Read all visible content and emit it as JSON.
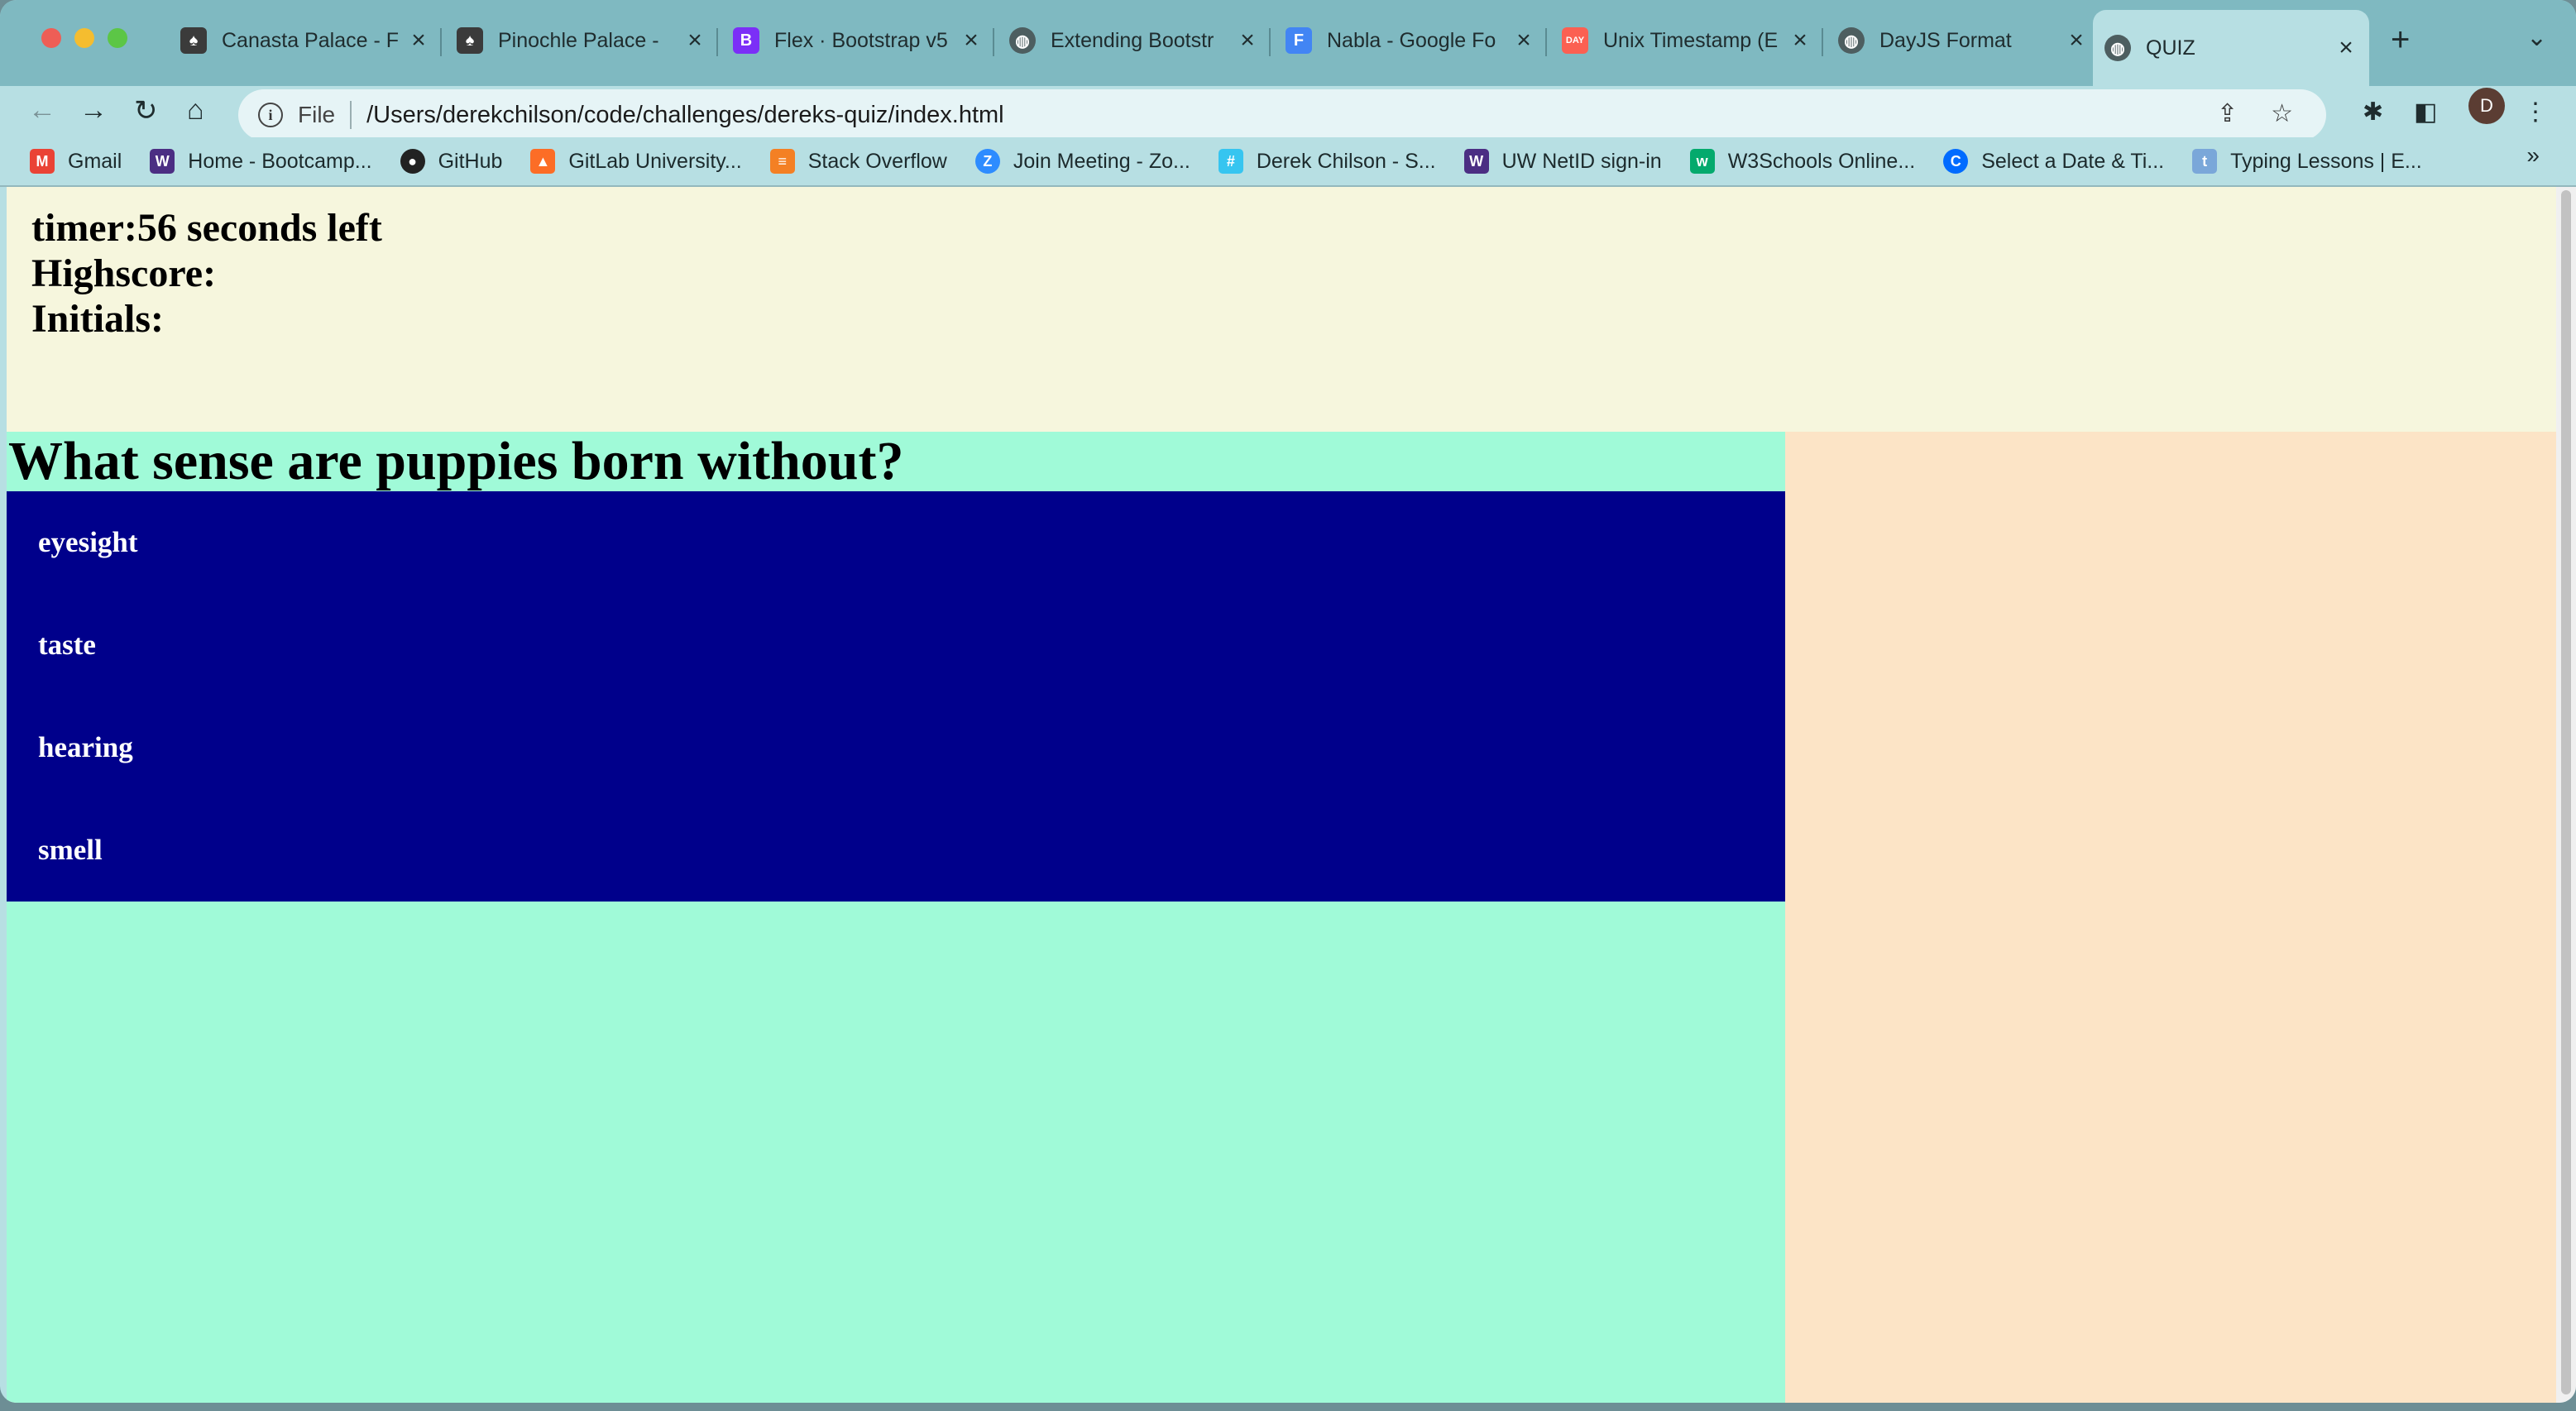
{
  "browser": {
    "tabs": [
      {
        "title": "Canasta Palace - F",
        "icon": "card-icon",
        "color": "#3b3b3b"
      },
      {
        "title": "Pinochle Palace -",
        "icon": "card-icon",
        "color": "#3b3b3b"
      },
      {
        "title": "Flex · Bootstrap v5",
        "icon": "bootstrap-icon",
        "color": "#7b2ff7"
      },
      {
        "title": "Extending Bootstr",
        "icon": "globe-icon",
        "color": "#333333"
      },
      {
        "title": "Nabla - Google Fo",
        "icon": "google-fonts-icon",
        "color": "#4285f4"
      },
      {
        "title": "Unix Timestamp (E",
        "icon": "dayjs-icon",
        "color": "#fb6052"
      },
      {
        "title": "DayJS Format",
        "icon": "globe-icon",
        "color": "#333333"
      },
      {
        "title": "QUIZ",
        "icon": "globe-icon",
        "color": "#333333",
        "active": true
      }
    ],
    "address": {
      "scheme": "File",
      "url": "/Users/derekchilson/code/challenges/dereks-quiz/index.html"
    },
    "profile_initial": "D",
    "bookmarks": [
      {
        "label": "Gmail",
        "icon": "gmail-icon",
        "color": "#ea4335",
        "glyph": "M"
      },
      {
        "label": "Home - Bootcamp...",
        "icon": "uw-icon",
        "color": "#4b2e83",
        "glyph": "W"
      },
      {
        "label": "GitHub",
        "icon": "github-icon",
        "color": "#222222",
        "glyph": "●"
      },
      {
        "label": "GitLab University...",
        "icon": "gitlab-icon",
        "color": "#fc6d26",
        "glyph": "▲"
      },
      {
        "label": "Stack Overflow",
        "icon": "stackoverflow-icon",
        "color": "#f48024",
        "glyph": "≡"
      },
      {
        "label": "Join Meeting - Zo...",
        "icon": "zoom-icon",
        "color": "#2d8cff",
        "glyph": "Z"
      },
      {
        "label": "Derek Chilson - S...",
        "icon": "slack-icon",
        "color": "#36c5f0",
        "glyph": "#"
      },
      {
        "label": "UW NetID sign-in",
        "icon": "uw-icon",
        "color": "#4b2e83",
        "glyph": "W"
      },
      {
        "label": "W3Schools Online...",
        "icon": "w3schools-icon",
        "color": "#04aa6d",
        "glyph": "w"
      },
      {
        "label": "Select a Date & Ti...",
        "icon": "calendly-icon",
        "color": "#006bff",
        "glyph": "C"
      },
      {
        "label": "Typing Lessons | E...",
        "icon": "typing-icon",
        "color": "#7aa7d9",
        "glyph": "t"
      }
    ]
  },
  "quiz": {
    "timer": "timer:56 seconds left",
    "highscore": "Highscore:",
    "initials": "Initials:",
    "question": "What sense are puppies born without?",
    "choices": [
      "eyesight",
      "taste",
      "hearing",
      "smell"
    ]
  },
  "colors": {
    "header_bg": "#f6f6dd",
    "quiz_bg": "#a0fad8",
    "choices_bg": "#00008b",
    "sidebar_bg": "#fce4c6"
  }
}
